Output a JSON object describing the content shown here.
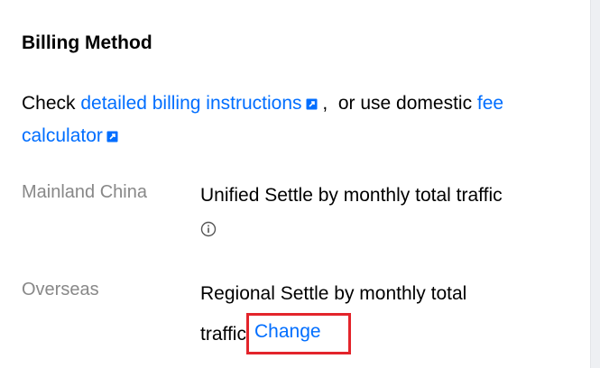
{
  "section": {
    "title": "Billing Method"
  },
  "description": {
    "prefix": "Check ",
    "billing_link": "detailed billing instructions",
    "middle": " ,  or use domestic ",
    "fee_link_line1": "fee",
    "fee_link_line2": "calculator"
  },
  "rows": [
    {
      "label": "Mainland China",
      "value": "Unified Settle by monthly total traffic"
    },
    {
      "label": "Overseas",
      "value_line1": "Regional Settle by monthly total",
      "value_line2": "traffic",
      "action_label": "Change"
    }
  ],
  "colors": {
    "link": "#006eff",
    "label": "#888888",
    "highlight": "#e3242b"
  }
}
